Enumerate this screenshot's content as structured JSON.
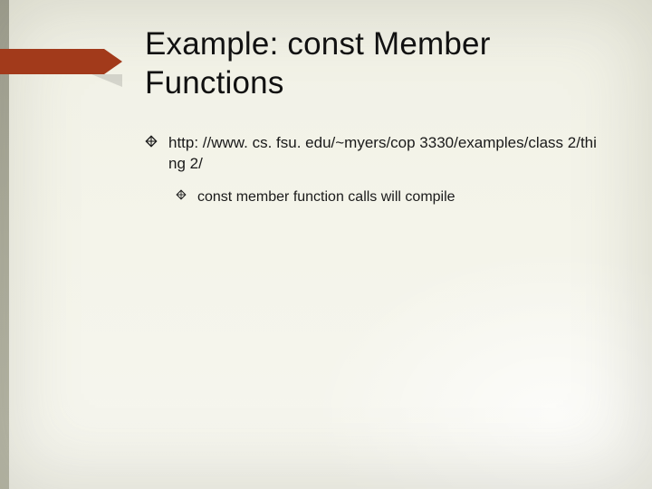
{
  "title": "Example:  const Member Functions",
  "bullets": [
    {
      "text": "http: //www. cs. fsu. edu/~myers/cop 3330/examples/class 2/thi ng 2/",
      "sub": [
        {
          "text": "const member function calls will compile"
        }
      ]
    }
  ],
  "accent_color": "#a23a1b",
  "icons": {
    "bullet": "diamond-open-icon"
  }
}
